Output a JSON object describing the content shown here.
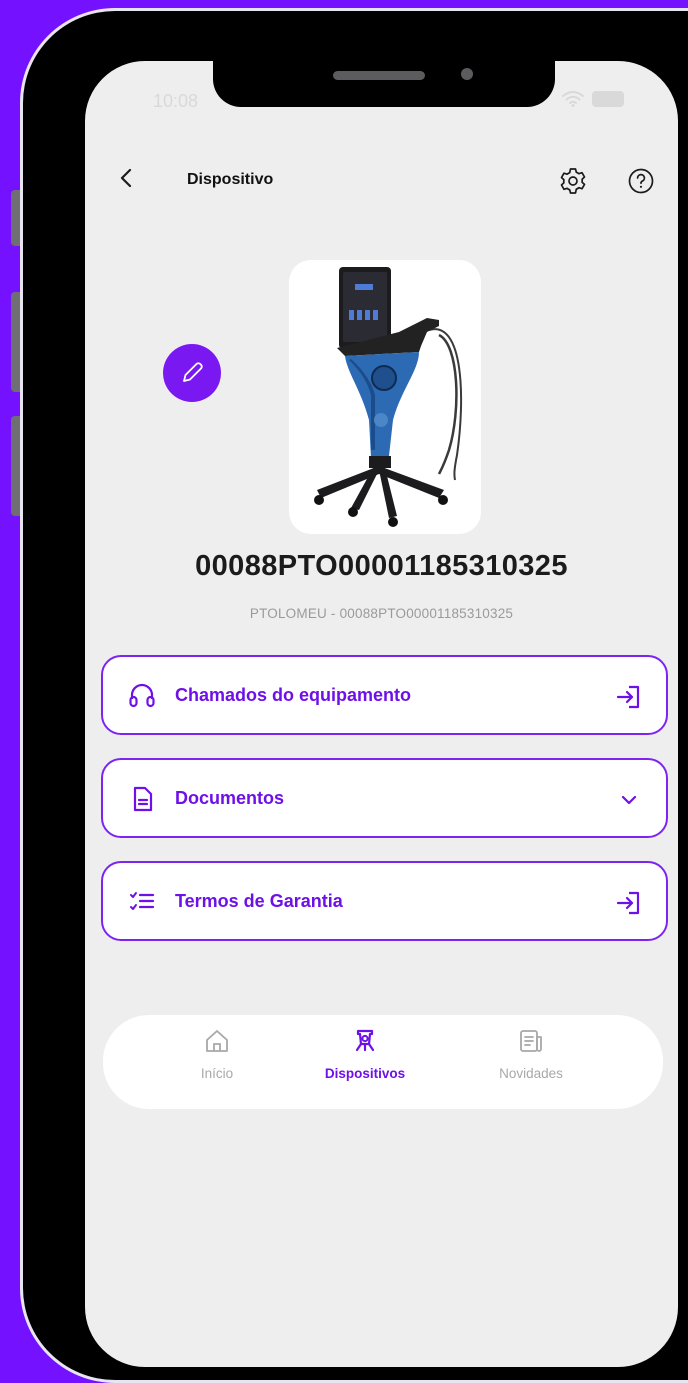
{
  "status": {
    "time": "10:08"
  },
  "header": {
    "title": "Dispositivo",
    "back_icon": "chevron-left-icon",
    "settings_icon": "gear-icon",
    "help_icon": "help-circle-icon"
  },
  "device": {
    "serial": "00088PTO00001185310325",
    "subtitle": "PTOLOMEU  - 00088PTO00001185310325"
  },
  "actions": [
    {
      "label": "Chamados do equipamento",
      "icon": "headset-icon",
      "trailing_icon": "enter-arrow-icon"
    },
    {
      "label": "Documentos",
      "icon": "document-icon",
      "trailing_icon": "chevron-down-icon"
    },
    {
      "label": "Termos de Garantia",
      "icon": "checklist-icon",
      "trailing_icon": "enter-arrow-icon"
    }
  ],
  "tabs": [
    {
      "label": "Início",
      "icon": "home-icon",
      "active": false
    },
    {
      "label": "Dispositivos",
      "icon": "device-icon",
      "active": true
    },
    {
      "label": "Novidades",
      "icon": "news-icon",
      "active": false
    }
  ],
  "colors": {
    "accent": "#7a18f2",
    "background": "#7412ff",
    "screen": "#eeeeee"
  }
}
